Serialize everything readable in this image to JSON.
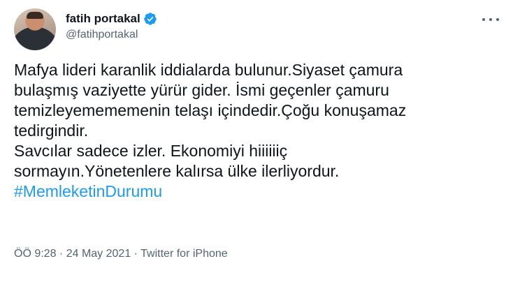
{
  "author": {
    "display_name": "fatih portakal",
    "handle": "@fatihportakal",
    "verified_color": "#1d9bf0"
  },
  "icons": {
    "avatar": "profile-photo",
    "verified": "verified-badge-icon",
    "more": "more-options-icon"
  },
  "tweet": {
    "lines": [
      "Mafya lideri karanlik iddialarda bulunur.Siyaset çamura",
      "bulaşmış vaziyette yürür gider. İsmi geçenler çamuru",
      "temizleyemememenin telaşı içindedir.Çoğu konuşamaz",
      "tedirgindir.",
      "Savcılar sadece izler. Ekonomiyi hiiiiiiç",
      "sormayın.Yönetenlere kalırsa ülke ilerliyordur."
    ],
    "hashtag": "#MemleketinDurumu"
  },
  "meta": {
    "time": "ÖÖ 9:28",
    "separator_1": " · ",
    "date": "24 May 2021",
    "separator_2": " · ",
    "source": "Twitter for iPhone"
  },
  "colors": {
    "text": "#0f1419",
    "secondary": "#536471",
    "link": "#1d9bf0"
  }
}
